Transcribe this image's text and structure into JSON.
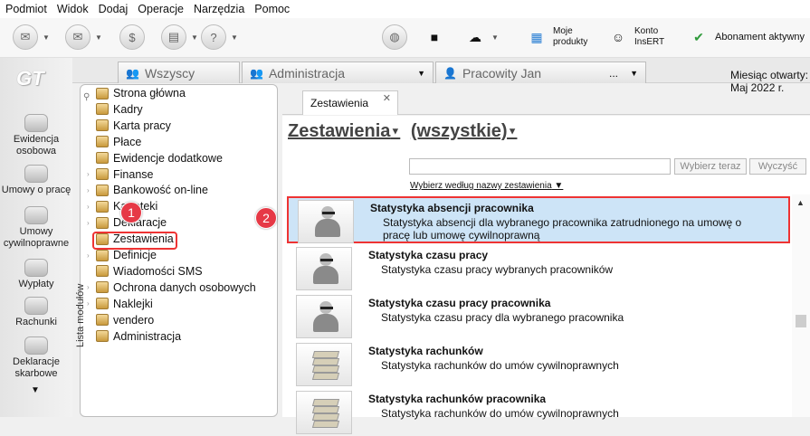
{
  "menu": [
    "Podmiot",
    "Widok",
    "Dodaj",
    "Operacje",
    "Narzędzia",
    "Pomoc"
  ],
  "toolbar": {
    "moje_produkty": "Moje\nprodukty",
    "konto": "Konto\nInsERT",
    "abonament": "Abonament aktywny"
  },
  "leftnav": {
    "logo": "GT",
    "items": [
      "Ewidencja\nosobowa",
      "Umowy o pracę",
      "Umowy\ncywilnoprawne",
      "Wypłaty",
      "Rachunki",
      "Deklaracje\nskarbowe"
    ]
  },
  "doc_tabs": [
    {
      "label": "Wszyscy"
    },
    {
      "label": "Administracja"
    },
    {
      "label": "Pracowity Jan",
      "more": "..."
    }
  ],
  "month": "Miesiąc otwarty:  Maj 2022 r.",
  "modules": {
    "vertical_label": "Lista modułów",
    "items": [
      "Strona główna",
      "Kadry",
      "Karta pracy",
      "Płace",
      "Ewidencje dodatkowe",
      "Finanse",
      "Bankowość on-line",
      "Kartoteki",
      "Deklaracje",
      "Zestawienia",
      "Definicje",
      "Wiadomości SMS",
      "Ochrona danych osobowych",
      "Naklejki",
      "vendero",
      "Administracja"
    ]
  },
  "badges": [
    "1",
    "2"
  ],
  "right_tab": "Zestawienia",
  "header": {
    "title": "Zestawienia",
    "filter": "(wszystkie)"
  },
  "search": {
    "button": "Wybierz teraz",
    "clear": "Wyczyść",
    "link": "Wybierz według nazwy zestawienia"
  },
  "rows": [
    {
      "title": "Statystyka absencji pracownika",
      "desc": "Statystyka absencji dla wybranego pracownika zatrudnionego na umowę o pracę lub umowę cywilnoprawną",
      "icon": "person-icon",
      "selected": true
    },
    {
      "title": "Statystyka czasu pracy",
      "desc": "Statystyka czasu pracy wybranych pracowników",
      "icon": "person-icon"
    },
    {
      "title": "Statystyka czasu pracy pracownika",
      "desc": "Statystyka czasu pracy dla wybranego pracownika",
      "icon": "person-icon"
    },
    {
      "title": "Statystyka rachunków",
      "desc": "Statystyka rachunków do umów cywilnoprawnych",
      "icon": "document-stack-icon"
    },
    {
      "title": "Statystyka rachunków pracownika",
      "desc": "Statystyka rachunków do umów cywilnoprawnych",
      "icon": "document-stack-icon"
    }
  ]
}
